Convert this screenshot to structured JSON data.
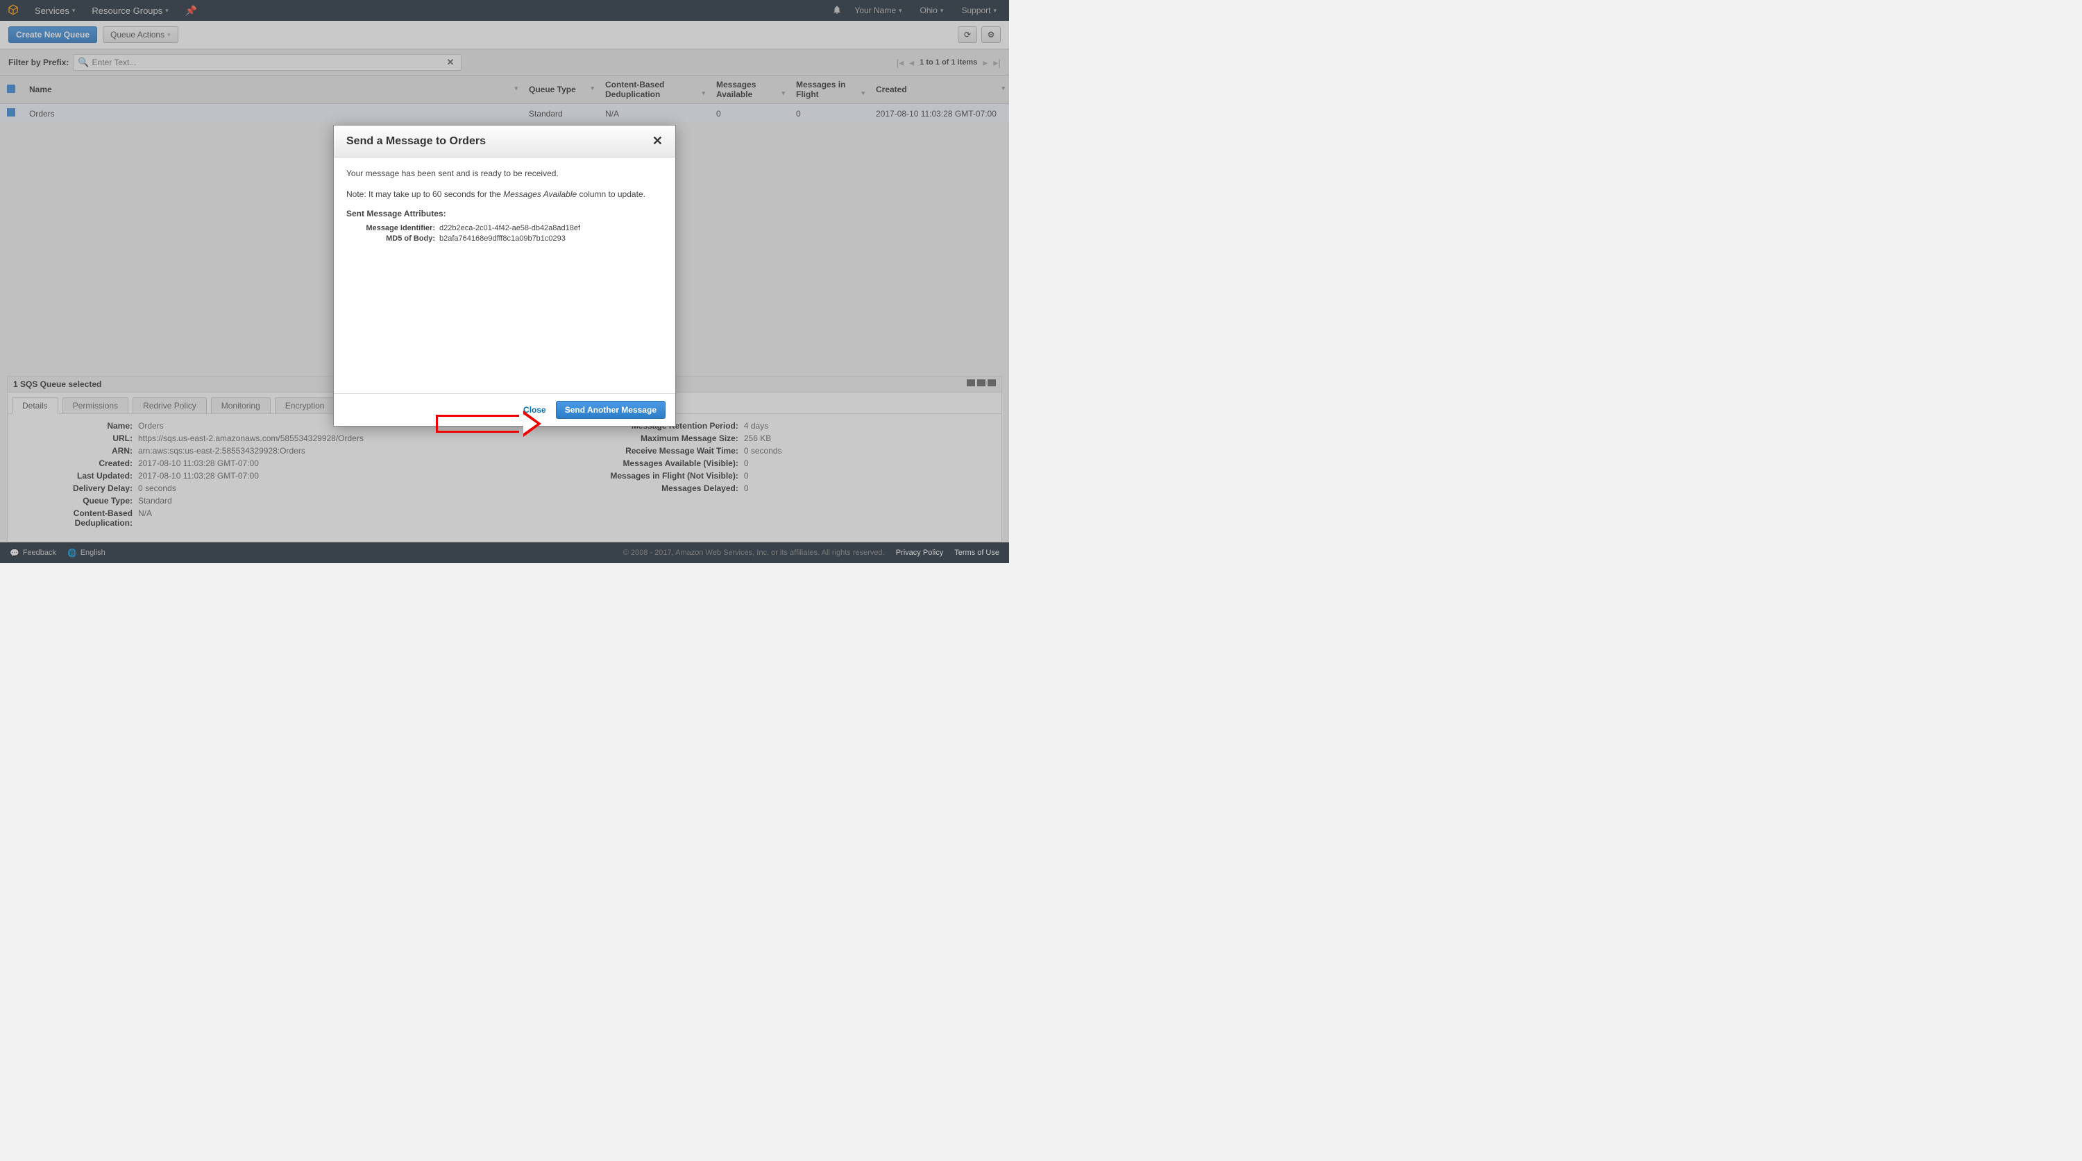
{
  "topnav": {
    "services": "Services",
    "resource_groups": "Resource Groups",
    "your_name": "Your Name",
    "region": "Ohio",
    "support": "Support"
  },
  "toolbar": {
    "create_queue": "Create New Queue",
    "queue_actions": "Queue Actions"
  },
  "filter": {
    "label": "Filter by Prefix:",
    "placeholder": "Enter Text...",
    "pagination": "1 to 1 of 1 items"
  },
  "table": {
    "headers": {
      "name": "Name",
      "queue_type": "Queue Type",
      "dedup": "Content-Based Deduplication",
      "avail": "Messages Available",
      "flight": "Messages in Flight",
      "created": "Created"
    },
    "row": {
      "name": "Orders",
      "type": "Standard",
      "dedup": "N/A",
      "avail": "0",
      "flight": "0",
      "created": "2017-08-10 11:03:28 GMT-07:00"
    }
  },
  "details": {
    "selected": "1 SQS Queue selected",
    "tabs": {
      "details": "Details",
      "permissions": "Permissions",
      "redrive": "Redrive Policy",
      "monitoring": "Monitoring",
      "encryption": "Encryption"
    },
    "col1": {
      "name_l": "Name:",
      "name_v": "Orders",
      "url_l": "URL:",
      "url_v": "https://sqs.us-east-2.amazonaws.com/585534329928/Orders",
      "arn_l": "ARN:",
      "arn_v": "arn:aws:sqs:us-east-2:585534329928:Orders",
      "created_l": "Created:",
      "created_v": "2017-08-10 11:03:28 GMT-07:00",
      "updated_l": "Last Updated:",
      "updated_v": "2017-08-10 11:03:28 GMT-07:00",
      "delay_l": "Delivery Delay:",
      "delay_v": "0 seconds",
      "qtype_l": "Queue Type:",
      "qtype_v": "Standard",
      "dedup_l": "Content-Based Deduplication:",
      "dedup_v": "N/A"
    },
    "col2": {
      "retention_l": "Message Retention Period:",
      "retention_v": "4 days",
      "maxsize_l": "Maximum Message Size:",
      "maxsize_v": "256 KB",
      "wait_l": "Receive Message Wait Time:",
      "wait_v": "0 seconds",
      "avail_l": "Messages Available (Visible):",
      "avail_v": "0",
      "flight_l": "Messages in Flight (Not Visible):",
      "flight_v": "0",
      "delayed_l": "Messages Delayed:",
      "delayed_v": "0"
    }
  },
  "modal": {
    "title": "Send a Message to Orders",
    "sent_text": "Your message has been sent and is ready to be received.",
    "note_prefix": "Note: It may take up to 60 seconds for the ",
    "note_ital": "Messages Available",
    "note_suffix": " column to update.",
    "attrs_title": "Sent Message Attributes:",
    "mid_l": "Message Identifier:",
    "mid_v": "d22b2eca-2c01-4f42-ae58-db42a8ad18ef",
    "md5_l": "MD5 of Body:",
    "md5_v": "b2afa764168e9dfff8c1a09b7b1c0293",
    "close": "Close",
    "send_another": "Send Another Message"
  },
  "footer": {
    "feedback": "Feedback",
    "english": "English",
    "copyright": "© 2008 - 2017, Amazon Web Services, Inc. or its affiliates. All rights reserved.",
    "privacy": "Privacy Policy",
    "terms": "Terms of Use"
  }
}
